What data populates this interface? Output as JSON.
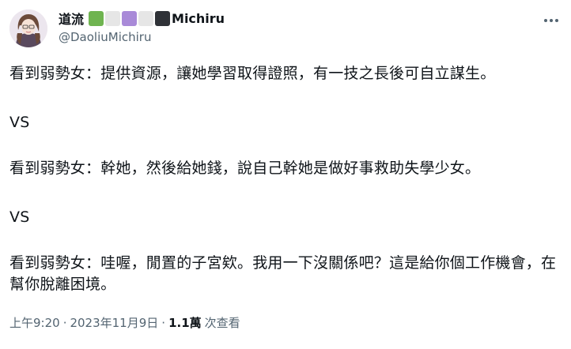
{
  "author": {
    "display_name": "道流",
    "name_suffix": "Michiru",
    "handle": "@DaoliuMichiru",
    "badge_colors": [
      "#6fb450",
      "#e6e6e6",
      "#a98ad8",
      "#e6e6e6",
      "#2f3237"
    ]
  },
  "tweet": {
    "paragraphs": [
      "看到弱勢女：提供資源，讓她學習取得證照，有一技之長後可自立謀生。",
      "VS",
      "看到弱勢女：幹她，然後給她錢，說自己幹她是做好事救助失學少女。",
      "VS",
      "看到弱勢女：哇喔，閒置的子宮欸。我用一下沒關係吧？這是給你個工作機會，在幫你脫離困境。"
    ]
  },
  "meta": {
    "time": "上午9:20",
    "separator": "·",
    "date": "2023年11月9日",
    "views_count": "1.1萬",
    "views_label": "次查看"
  }
}
